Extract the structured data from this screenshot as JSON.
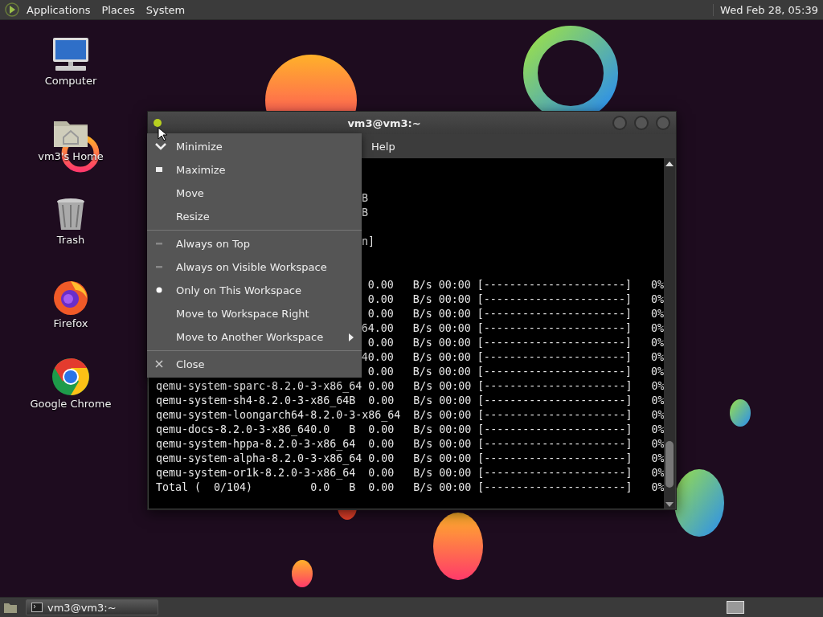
{
  "top_panel": {
    "menus": [
      "Applications",
      "Places",
      "System"
    ],
    "clock": "Wed Feb 28, 05:39"
  },
  "desktop_icons": [
    {
      "label": "Computer",
      "kind": "computer"
    },
    {
      "label": "vm3's Home",
      "kind": "home"
    },
    {
      "label": "Trash",
      "kind": "trash"
    },
    {
      "label": "Firefox",
      "kind": "firefox"
    },
    {
      "label": "Google Chrome",
      "kind": "chrome"
    }
  ],
  "window": {
    "title": "vm3@vm3:~",
    "menubar": [
      "Help"
    ],
    "terminal_lines": [
      {
        "kind": "hidden"
      },
      {
        "kind": "hidden"
      },
      {
        "kind": "mid",
        "text": "B"
      },
      {
        "kind": "mid",
        "text": "B"
      },
      {
        "kind": "hidden"
      },
      {
        "kind": "mid",
        "text": "n]"
      },
      {
        "kind": "hidden"
      },
      {
        "kind": "hidden"
      },
      {
        "kind": "tail",
        "text": "0.00   B/s 00:00 [----------------------]   0%"
      },
      {
        "kind": "tail",
        "text": "0.00   B/s 00:00 [----------------------]   0%"
      },
      {
        "kind": "tail",
        "text": "0.00   B/s 00:00 [----------------------]   0%"
      },
      {
        "kind": "tail",
        "text": "64.00   B/s 00:00 [----------------------]   0%"
      },
      {
        "kind": "tail",
        "text": "0.00   B/s 00:00 [----------------------]   0%"
      },
      {
        "kind": "tail",
        "text": "40.00   B/s 00:00 [----------------------]   0%"
      },
      {
        "kind": "tail",
        "text": "0.00   B/s 00:00 [----------------------]   0%"
      },
      {
        "kind": "full",
        "text": "qemu-system-sparc-8.2.0-3-x86_64 0.00   B/s 00:00 [----------------------]   0%"
      },
      {
        "kind": "full",
        "text": "qemu-system-sh4-8.2.0-3-x86_64B  0.00   B/s 00:00 [----------------------]   0%"
      },
      {
        "kind": "full",
        "text": "qemu-system-loongarch64-8.2.0-3-x86_64  B/s 00:00 [----------------------]   0%"
      },
      {
        "kind": "full",
        "text": "qemu-docs-8.2.0-3-x86_640.0   B  0.00   B/s 00:00 [----------------------]   0%"
      },
      {
        "kind": "full",
        "text": "qemu-system-hppa-8.2.0-3-x86_64  0.00   B/s 00:00 [----------------------]   0%"
      },
      {
        "kind": "full",
        "text": "qemu-system-alpha-8.2.0-3-x86_64 0.00   B/s 00:00 [----------------------]   0%"
      },
      {
        "kind": "full",
        "text": "qemu-system-or1k-8.2.0-3-x86_64  0.00   B/s 00:00 [----------------------]   0%"
      },
      {
        "kind": "full",
        "text": "Total (  0/104)         0.0   B  0.00   B/s 00:00 [----------------------]   0%"
      }
    ]
  },
  "window_menu": {
    "items": [
      {
        "label": "Minimize",
        "kind": "minimize"
      },
      {
        "label": "Maximize",
        "kind": "maximize"
      },
      {
        "label": "Move",
        "kind": "plain"
      },
      {
        "label": "Resize",
        "kind": "plain"
      },
      {
        "kind": "separator"
      },
      {
        "label": "Always on Top",
        "kind": "check",
        "checked": false
      },
      {
        "label": "Always on Visible Workspace",
        "kind": "radio",
        "selected": false
      },
      {
        "label": "Only on This Workspace",
        "kind": "radio",
        "selected": true
      },
      {
        "label": "Move to Workspace Right",
        "kind": "plain"
      },
      {
        "label": "Move to Another Workspace",
        "kind": "submenu"
      },
      {
        "kind": "separator"
      },
      {
        "label": "Close",
        "kind": "close"
      }
    ]
  },
  "taskbar": {
    "tasks": [
      {
        "label": "vm3@vm3:~",
        "selected": true
      }
    ]
  }
}
